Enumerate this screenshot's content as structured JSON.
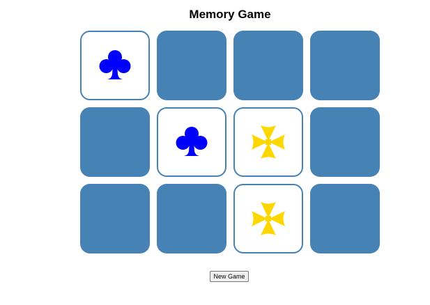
{
  "game": {
    "title": "Memory Game",
    "new_game_label": "New Game",
    "colors": {
      "card_back": "#4682b4",
      "card_face": "#ffffff",
      "card_border": "#4682b4",
      "club": "#0000ff",
      "cross": "#ffd700"
    },
    "board": {
      "rows": 3,
      "columns": 4,
      "cards": [
        {
          "state": "face-up",
          "symbol": "club-icon"
        },
        {
          "state": "face-down",
          "symbol": ""
        },
        {
          "state": "face-down",
          "symbol": ""
        },
        {
          "state": "face-down",
          "symbol": ""
        },
        {
          "state": "face-down",
          "symbol": ""
        },
        {
          "state": "face-up",
          "symbol": "club-icon"
        },
        {
          "state": "face-up",
          "symbol": "cross-pattee-icon"
        },
        {
          "state": "face-down",
          "symbol": ""
        },
        {
          "state": "face-down",
          "symbol": ""
        },
        {
          "state": "face-down",
          "symbol": ""
        },
        {
          "state": "face-up",
          "symbol": "cross-pattee-icon"
        },
        {
          "state": "face-down",
          "symbol": ""
        }
      ]
    }
  }
}
